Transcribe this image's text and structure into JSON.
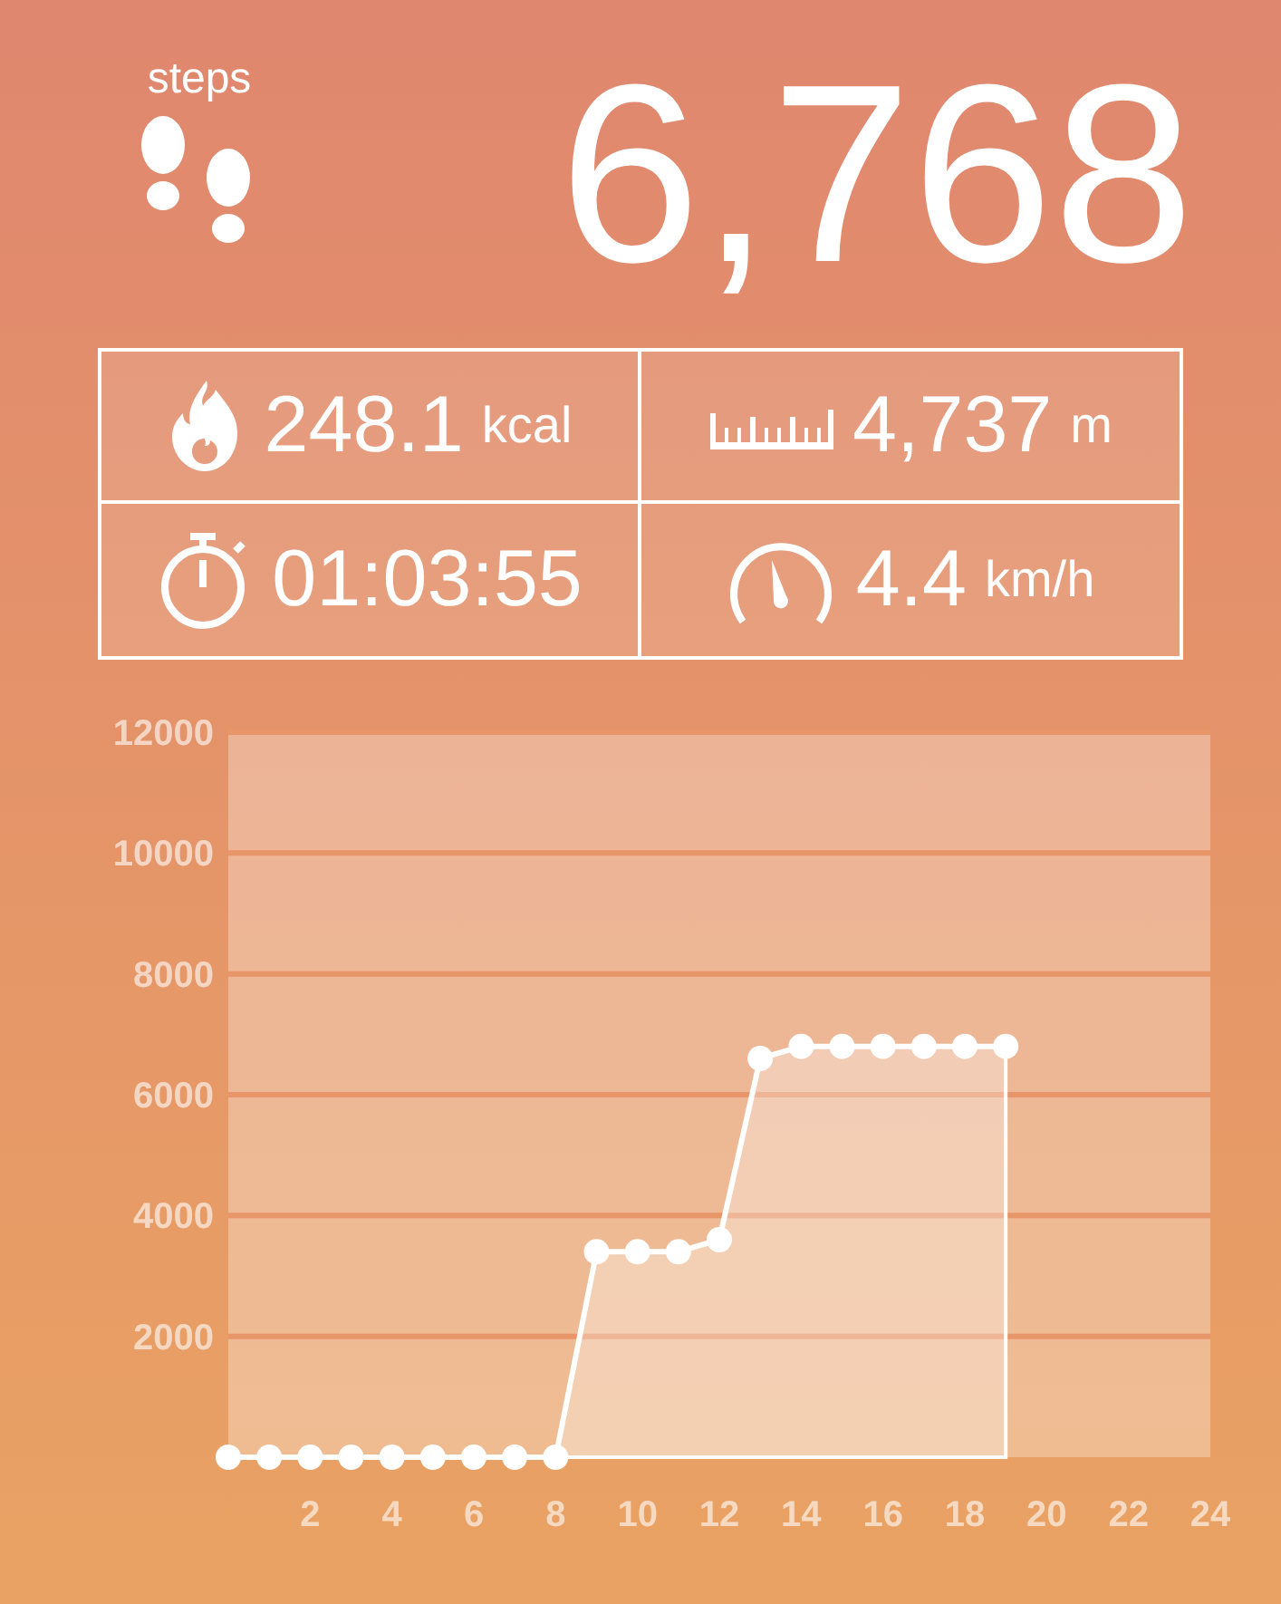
{
  "header": {
    "label": "steps",
    "count": "6,768"
  },
  "stats": [
    {
      "kind": "calories",
      "value": "248.1",
      "unit": "kcal"
    },
    {
      "kind": "distance",
      "value": "4,737",
      "unit": "m"
    },
    {
      "kind": "duration",
      "value": "01:03:55"
    },
    {
      "kind": "speed",
      "value": "4.4",
      "unit": "km/h"
    }
  ],
  "chart_data": {
    "type": "area",
    "x": [
      0,
      1,
      2,
      3,
      4,
      5,
      6,
      7,
      8,
      9,
      10,
      11,
      12,
      13,
      14,
      15,
      16,
      17,
      18,
      19
    ],
    "series": [
      {
        "color": "#ffffff",
        "values": [
          0,
          0,
          0,
          0,
          0,
          0,
          0,
          0,
          0,
          3400,
          3400,
          3400,
          3600,
          6600,
          6800,
          6800,
          6800,
          6800,
          6800,
          6800
        ]
      }
    ],
    "grid": true,
    "xlim": [
      0,
      24
    ],
    "ylim": [
      0,
      12000
    ],
    "xticks": [
      2,
      4,
      6,
      8,
      10,
      12,
      14,
      16,
      18,
      20,
      22,
      24
    ],
    "yticks": [
      2000,
      4000,
      6000,
      8000,
      10000,
      12000
    ]
  }
}
